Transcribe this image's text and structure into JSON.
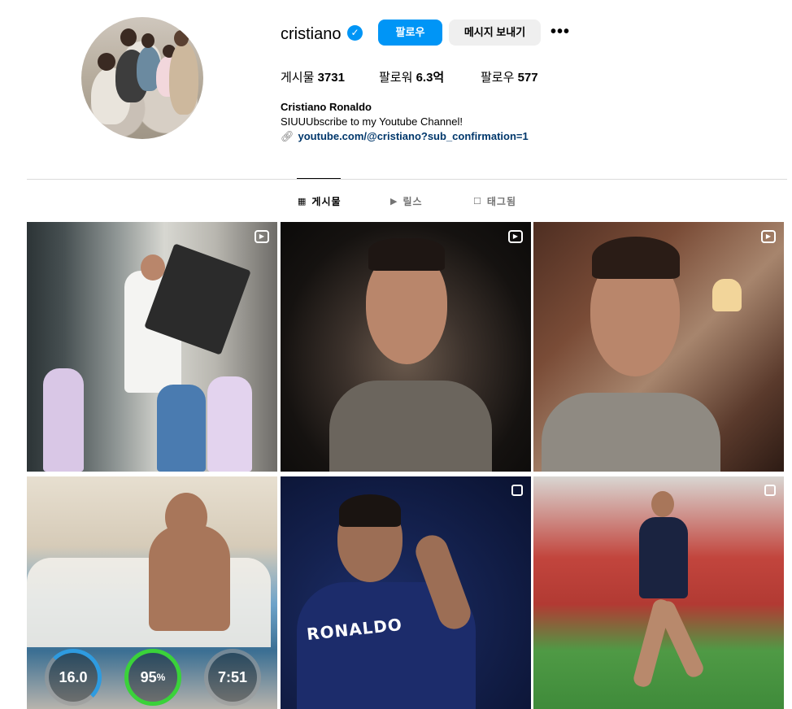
{
  "profile": {
    "username": "cristiano",
    "verified_icon": "verified-badge-icon",
    "follow_label": "팔로우",
    "message_label": "메시지 보내기",
    "more_label": "•••",
    "stats": {
      "posts_label": "게시물",
      "posts_value": "3731",
      "followers_label": "팔로워",
      "followers_value": "6.3억",
      "following_label": "팔로우",
      "following_value": "577"
    },
    "full_name": "Cristiano Ronaldo",
    "bio": "SIUUUbscribe to my Youtube Channel!",
    "link": "youtube.com/@cristiano?sub_confirmation=1"
  },
  "tabs": [
    {
      "label": "게시물",
      "icon": "grid-icon",
      "active": true
    },
    {
      "label": "릴스",
      "icon": "reels-icon",
      "active": false
    },
    {
      "label": "태그됨",
      "icon": "tagged-icon",
      "active": false
    }
  ],
  "posts": [
    {
      "type": "reel",
      "icon": "reel-icon"
    },
    {
      "type": "reel",
      "icon": "reel-icon"
    },
    {
      "type": "reel",
      "icon": "reel-icon"
    },
    {
      "type": "image",
      "overlay": {
        "ring1": "16.0",
        "ring2": "95",
        "ring2_unit": "%",
        "ring3": "7:51"
      }
    },
    {
      "type": "carousel",
      "icon": "carousel-icon",
      "overlay": {
        "jersey": "RONALDO"
      }
    },
    {
      "type": "carousel",
      "icon": "carousel-icon"
    }
  ],
  "colors": {
    "accent": "#0095f6",
    "link": "#00376b",
    "muted": "#737373"
  }
}
